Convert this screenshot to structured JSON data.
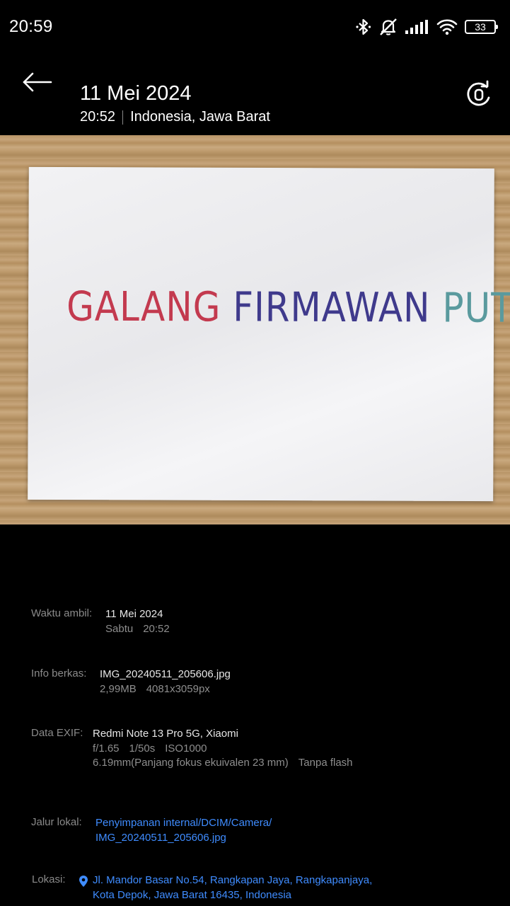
{
  "status_bar": {
    "time": "20:59",
    "battery": "33",
    "icons": [
      "bluetooth-icon",
      "muted-bell-icon",
      "signal-icon",
      "wifi-icon",
      "battery-icon"
    ]
  },
  "header": {
    "date": "11 Mei 2024",
    "time": "20:52",
    "location": "Indonesia, Jawa Barat"
  },
  "photo": {
    "handwriting": [
      "GALANG",
      "FIRMAWAN",
      "PUTRA"
    ]
  },
  "details": {
    "waktu": {
      "label": "Waktu ambil:",
      "date": "11 Mei 2024",
      "day": "Sabtu",
      "time": "20:52"
    },
    "berkas": {
      "label": "Info berkas:",
      "filename": "IMG_20240511_205606.jpg",
      "size": "2,99MB",
      "resolution": "4081x3059px"
    },
    "exif": {
      "label": "Data EXIF:",
      "device": "Redmi Note 13 Pro 5G, Xiaomi",
      "aperture": "f/1.65",
      "shutter": "1/50s",
      "iso": "ISO1000",
      "focal": "6.19mm(Panjang fokus ekuivalen 23 mm)",
      "flash": "Tanpa flash"
    },
    "jalur": {
      "label": "Jalur lokal:",
      "line1": "Penyimpanan internal/DCIM/Camera/",
      "line2": "IMG_20240511_205606.jpg"
    },
    "lokasi": {
      "label": "Lokasi:",
      "line1": "Jl. Mandor Basar No.54, Rangkapan Jaya, Rangkapanjaya,",
      "line2": "Kota Depok, Jawa Barat 16435, Indonesia"
    }
  },
  "colors": {
    "background": "#000000",
    "link": "#3f8cff",
    "label": "#8a8a8a"
  }
}
